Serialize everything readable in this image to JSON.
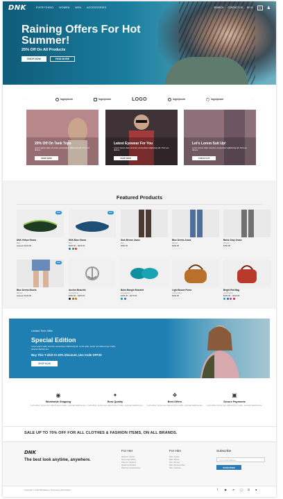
{
  "nav": {
    "logo": "DNK",
    "links": [
      "EVERYTHING",
      "WOMEN",
      "MEN",
      "ACCESSORIES"
    ],
    "right": [
      "SEARCH",
      "CONTACT US",
      "$0.00"
    ],
    "cart_count": "0",
    "user_icon": "user-icon"
  },
  "hero": {
    "title": "Raining Offers For Hot Summer!",
    "subtitle": "25% Off On All Products",
    "shop_now": "SHOP NOW",
    "find_more": "FIND MORE"
  },
  "brands": [
    "logoipsum",
    "logoipsum",
    "LOGO",
    "logoipsum",
    "logoipsum"
  ],
  "promos": [
    {
      "title": "20% Off On Tank Tops",
      "text": "Lorem ipsum dolor sit amet, consectetur adipiscing elit. Proin ac dictum.",
      "button": "SHOP NOW",
      "bg": "#b7878a"
    },
    {
      "title": "Latest Eyewear For You",
      "text": "Lorem ipsum dolor sit amet, consectetur adipiscing elit. Proin ac dictum.",
      "button": "SHOP NOW",
      "bg": "#3f3236"
    },
    {
      "title": "Let's Lorem Suit Up!",
      "text": "Lorem ipsum dolor sit amet, consectetur adipiscing elit. Proin ac dictum.",
      "button": "CHECK OUT",
      "bg": "#8d7079"
    }
  ],
  "featured": {
    "title": "Featured Products",
    "products": [
      {
        "name": "DNK Yellow Shoes",
        "cat": "Men",
        "old": "$150.00",
        "price": "$120.00",
        "sale": "Sale!",
        "stars": "☆☆☆☆☆",
        "colors": []
      },
      {
        "name": "DNK Blue Shoes",
        "cat": "Men",
        "old": "",
        "price": "$200.00 – $240.00",
        "sale": "Sale!",
        "stars": "☆☆☆☆☆",
        "colors": [
          "#1e6fb5",
          "#2e9a45",
          "#c23a2a"
        ]
      },
      {
        "name": "Dark Brown Jeans",
        "cat": "Men",
        "old": "",
        "price": "$150.00",
        "sale": "",
        "stars": "☆☆☆☆☆",
        "colors": []
      },
      {
        "name": "Blue Denim Jeans",
        "cat": "Women",
        "old": "",
        "price": "$150.00",
        "sale": "",
        "stars": "☆☆☆☆☆",
        "colors": []
      },
      {
        "name": "Basic Gray Jeans",
        "cat": "Women",
        "old": "",
        "price": "$150.00",
        "sale": "",
        "stars": "☆☆☆☆☆",
        "colors": []
      },
      {
        "name": "Blue Denim Shorts",
        "cat": "Women",
        "old": "$150.00",
        "price": "$130.00",
        "sale": "Sale!",
        "stars": "☆☆☆☆☆",
        "colors": []
      },
      {
        "name": "Anchor Bracelet",
        "cat": "Accessories",
        "old": "",
        "price": "$150.00 – $180.00",
        "sale": "",
        "stars": "☆☆☆☆☆",
        "colors": [
          "#111111",
          "#8a6a3a",
          "#c4731f"
        ]
      },
      {
        "name": "Boho Bangle Bracelet",
        "cat": "Accessories",
        "old": "",
        "price": "$150.00 – $170.00",
        "sale": "",
        "stars": "☆☆☆☆☆",
        "colors": [
          "#0f8fa0",
          "#2a6fb0"
        ]
      },
      {
        "name": "Light Brown Purse",
        "cat": "Accessories",
        "old": "",
        "price": "$150.00",
        "sale": "",
        "stars": "☆☆☆☆☆",
        "colors": []
      },
      {
        "name": "Bright Red Bag",
        "cat": "Accessories",
        "old": "",
        "price": "$100.00 – $120.00",
        "sale": "",
        "stars": "☆☆☆☆☆",
        "colors": [
          "#1aa0c0",
          "#2a5fb0",
          "#b03aa0",
          "#c02a3a"
        ]
      }
    ]
  },
  "special": {
    "label": "Limited Time Offer",
    "title": "Special Edition",
    "text": "Lorem ipsum dolor sit amet, consectetur adipiscing elit. Ut elit tellus, luctus nec ullamcorper mattis, pulvinar dapibus leo.",
    "offer": "Buy This T-shirt At 20% Discount, Use Code OFF20",
    "button": "SHOP NOW"
  },
  "features": [
    {
      "icon": "globe-icon",
      "title": "Worldwide Shipping",
      "text": "It elit tellus, luctus nec ullamcorper mattis, pulvinar dapibus leo."
    },
    {
      "icon": "medal-icon",
      "title": "Best Quality",
      "text": "It elit tellus, luctus nec ullamcorper mattis, pulvinar dapibus leo."
    },
    {
      "icon": "tag-icon",
      "title": "Best Offers",
      "text": "It elit tellus, luctus nec ullamcorper mattis, pulvinar dapibus leo."
    },
    {
      "icon": "lock-icon",
      "title": "Secure Payments",
      "text": "It elit tellus, luctus nec ullamcorper mattis, pulvinar dapibus leo."
    }
  ],
  "sale_strip": "SALE UP TO 70% OFF FOR ALL CLOTHES & FASHION ITEMS, ON ALL BRANDS.",
  "footer": {
    "logo": "DNK",
    "tagline": "The best look anytime, anywhere.",
    "for_her": {
      "head": "For Her",
      "links": [
        "Women Jeans",
        "Tops and Shirts",
        "Women Jackets",
        "Heels and Flats",
        "Women Accessories"
      ]
    },
    "for_him": {
      "head": "For Him",
      "links": [
        "Men Jeans",
        "Men Shirts",
        "Men Shoes",
        "Men Accessories",
        "Men Jackets"
      ]
    },
    "subscribe": {
      "head": "Subscribe",
      "placeholder": "Your email address...",
      "button": "SUBSCRIBE"
    },
    "copyright": "Copyright © 2022 Brandstore. Powered by Brandstore.",
    "social": [
      "facebook-icon",
      "youtube-icon",
      "twitter-icon",
      "instagram-icon",
      "google-icon",
      "github-icon"
    ]
  }
}
